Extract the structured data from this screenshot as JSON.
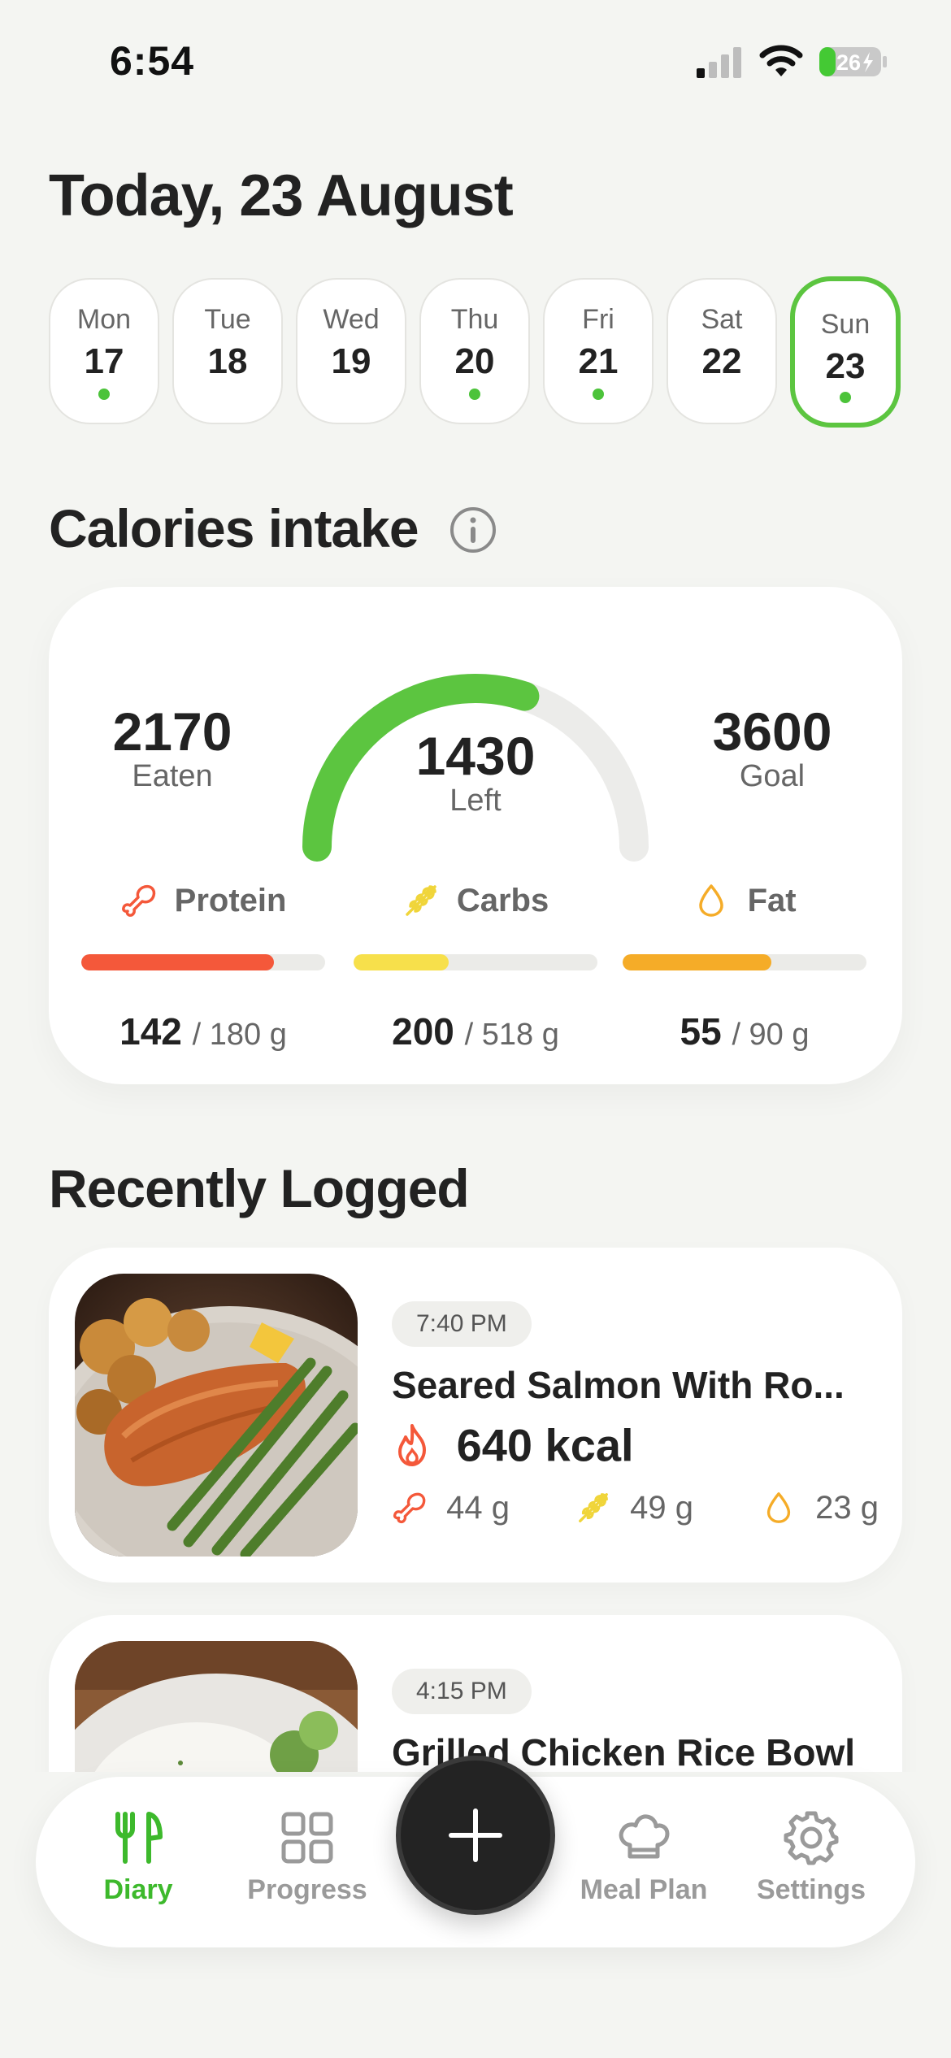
{
  "status_bar": {
    "time": "6:54",
    "battery": "26"
  },
  "header": {
    "date_title": "Today, 23 August"
  },
  "week": [
    {
      "name": "Mon",
      "num": "17",
      "logged": true
    },
    {
      "name": "Tue",
      "num": "18",
      "logged": false
    },
    {
      "name": "Wed",
      "num": "19",
      "logged": false
    },
    {
      "name": "Thu",
      "num": "20",
      "logged": true
    },
    {
      "name": "Fri",
      "num": "21",
      "logged": true
    },
    {
      "name": "Sat",
      "num": "22",
      "logged": false
    },
    {
      "name": "Sun",
      "num": "23",
      "logged": true,
      "selected": true
    }
  ],
  "calories": {
    "heading": "Calories intake",
    "eaten_value": "2170",
    "eaten_label": "Eaten",
    "left_value": "1430",
    "left_label": "Left",
    "goal_value": "3600",
    "goal_label": "Goal",
    "progress_fraction": 0.6,
    "gauge_color": "#5cc540",
    "macros": [
      {
        "name": "Protein",
        "value": "142",
        "target": "/ 180 g",
        "fraction": 0.79,
        "color": "#f4583a",
        "icon": "drumstick-icon"
      },
      {
        "name": "Carbs",
        "value": "200",
        "target": "/ 518 g",
        "fraction": 0.39,
        "color": "#f7e04b",
        "icon": "wheat-icon"
      },
      {
        "name": "Fat",
        "value": "55",
        "target": "/ 90 g",
        "fraction": 0.61,
        "color": "#f5ac28",
        "icon": "drop-icon"
      }
    ]
  },
  "recent": {
    "heading": "Recently Logged",
    "meals": [
      {
        "time": "7:40 PM",
        "name": "Seared Salmon With Ro...",
        "kcal": "640 kcal",
        "protein": "44 g",
        "carbs": "49 g",
        "fat": "23 g"
      },
      {
        "time": "4:15 PM",
        "name": "Grilled Chicken Rice Bowl"
      }
    ]
  },
  "nav": {
    "diary": "Diary",
    "progress": "Progress",
    "meal_plan": "Meal Plan",
    "settings": "Settings",
    "active_color": "#3db92c"
  }
}
